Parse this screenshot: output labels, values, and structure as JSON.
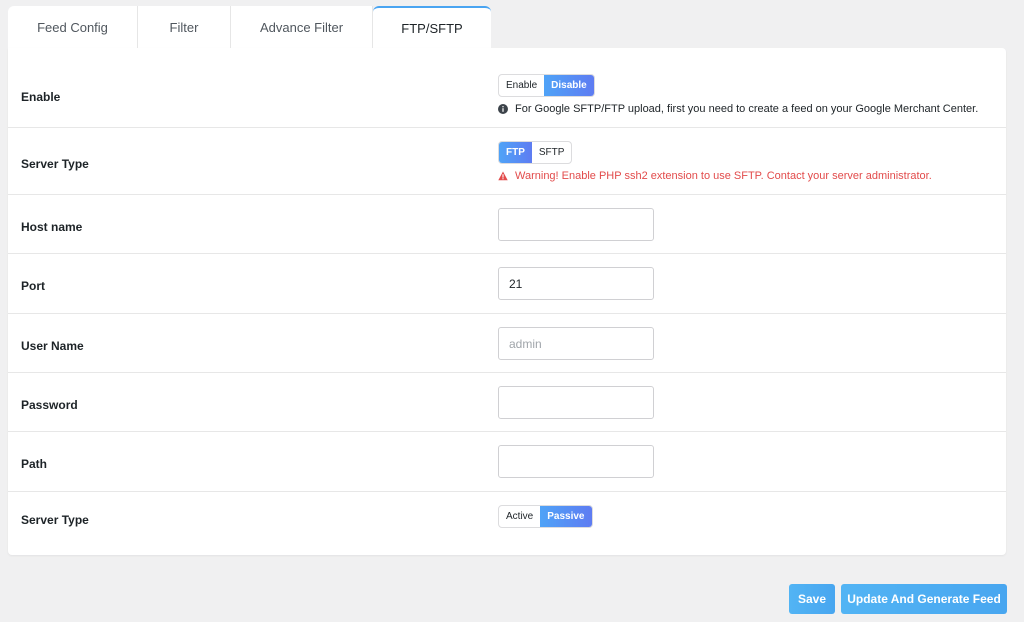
{
  "tabs": [
    {
      "label": "Feed Config"
    },
    {
      "label": "Filter"
    },
    {
      "label": "Advance Filter"
    },
    {
      "label": "FTP/SFTP"
    }
  ],
  "rows": {
    "enable": {
      "label": "Enable",
      "options": [
        "Enable",
        "Disable"
      ],
      "selected": "Disable",
      "note": "For Google SFTP/FTP upload, first you need to create a feed on your Google Merchant Center."
    },
    "server_type": {
      "label": "Server Type",
      "options": [
        "FTP",
        "SFTP"
      ],
      "selected": "FTP",
      "warning": "Warning! Enable PHP ssh2 extension to use SFTP. Contact your server administrator."
    },
    "host": {
      "label": "Host name",
      "value": "",
      "placeholder": ""
    },
    "port": {
      "label": "Port",
      "value": "21",
      "placeholder": ""
    },
    "username": {
      "label": "User Name",
      "value": "",
      "placeholder": "admin"
    },
    "password": {
      "label": "Password",
      "value": "",
      "placeholder": ""
    },
    "path": {
      "label": "Path",
      "value": "",
      "placeholder": ""
    },
    "mode": {
      "label": "Server Type",
      "options": [
        "Active",
        "Passive"
      ],
      "selected": "Passive"
    }
  },
  "actions": {
    "save_label": "Save",
    "update_label": "Update And Generate Feed"
  },
  "colors": {
    "accent": "#4fa3f7",
    "warning": "#e24b4b",
    "button": "#4aa9f2"
  },
  "icons": {
    "info": "info-circle-icon",
    "warning": "warning-triangle-icon"
  }
}
